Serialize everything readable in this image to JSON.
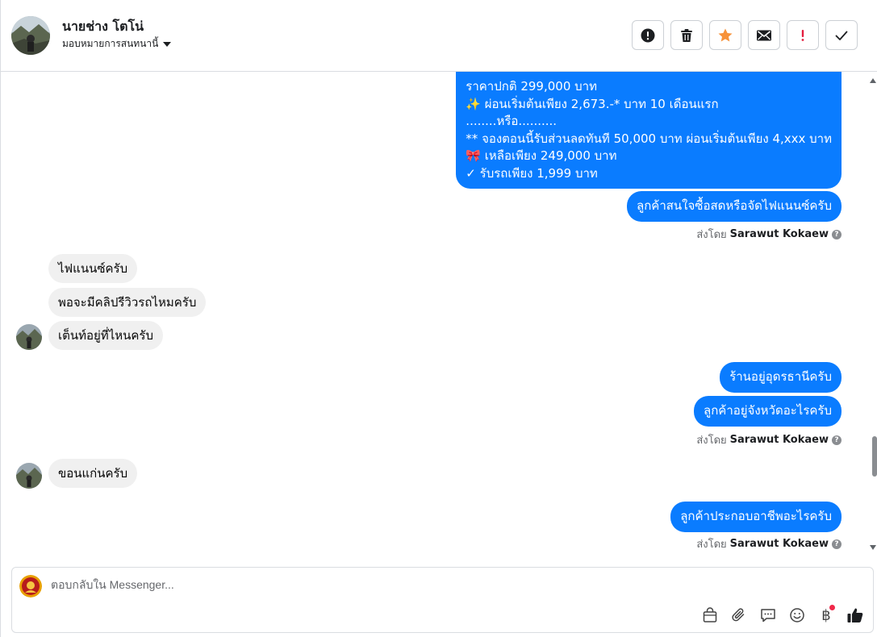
{
  "header": {
    "name": "นายช่าง โตโน่",
    "assign_label": "มอบหมายการสนทนานี้",
    "actions": [
      {
        "name": "report-spam-button",
        "icon": "alert-circle-icon"
      },
      {
        "name": "delete-button",
        "icon": "trash-icon"
      },
      {
        "name": "star-button",
        "icon": "star-icon"
      },
      {
        "name": "mark-unread-button",
        "icon": "envelope-icon"
      },
      {
        "name": "follow-up-button",
        "icon": "exclamation-icon"
      },
      {
        "name": "mark-done-button",
        "icon": "check-icon"
      }
    ]
  },
  "messages": {
    "promo_lines": [
      "ราคาปกติ 299,000 บาท",
      "✨  ผ่อนเริ่มต้นเพียง 2,673.-* บาท 10 เดือนแรก",
      "........หรือ..........",
      "** จองตอนนี้รับส่วนลดทันที 50,000 บาท ผ่อนเริ่มต้นเพียง 4,xxx บาท",
      "🎀  เหลือเพียง 249,000 บาท",
      "✓ รับรถเพียง 1,999 บาท"
    ],
    "out_1": "ลูกค้าสนใจซื้อสดหรือจัดไฟแนนซ์ครับ",
    "in_1": "ไฟแนนซ์ครับ",
    "in_2": "พอจะมีคลิปรีวิวรถไหมครับ",
    "in_3": "เต็นท์อยู่ที่ไหนครับ",
    "out_2": "ร้านอยู่อุดรธานีครับ",
    "out_3": "ลูกค้าอยู่จังหวัดอะไรครับ",
    "in_4": "ขอนแก่นครับ",
    "out_4": "ลูกค้าประกอบอาชีพอะไรครับ",
    "sent_by_prefix": "ส่งโดย",
    "sent_by_name": "Sarawut Kokaew",
    "help_mark": "?"
  },
  "composer": {
    "placeholder": "ตอบกลับใน Messenger...",
    "tools": [
      "bag-icon",
      "paperclip-icon",
      "saved-reply-icon",
      "emoji-icon",
      "baht-icon",
      "like-icon"
    ],
    "baht_symbol": "฿"
  },
  "colors": {
    "outgoing": "#0a7cff",
    "incoming": "#f0f0f0",
    "star": "#f7923a",
    "follow_up": "#e41e3f",
    "notification_dot": "#f02849"
  }
}
